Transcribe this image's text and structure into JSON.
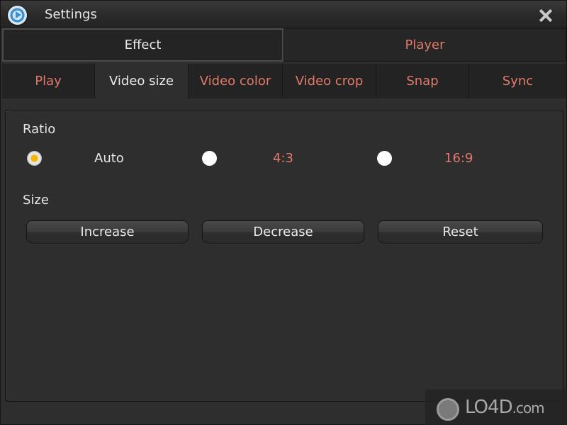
{
  "window": {
    "title": "Settings",
    "close_icon": "close-icon",
    "app_icon": "media-player-icon"
  },
  "top_tabs": [
    {
      "label": "Effect",
      "active": true
    },
    {
      "label": "Player",
      "active": false
    }
  ],
  "sub_tabs": [
    {
      "label": "Play",
      "active": false
    },
    {
      "label": "Video size",
      "active": true
    },
    {
      "label": "Video color",
      "active": false
    },
    {
      "label": "Video crop",
      "active": false
    },
    {
      "label": "Snap",
      "active": false
    },
    {
      "label": "Sync",
      "active": false
    }
  ],
  "ratio": {
    "label": "Ratio",
    "options": [
      {
        "label": "Auto",
        "checked": true
      },
      {
        "label": "4:3",
        "checked": false
      },
      {
        "label": "16:9",
        "checked": false
      }
    ]
  },
  "size": {
    "label": "Size",
    "buttons": [
      "Increase",
      "Decrease",
      "Reset"
    ]
  },
  "watermark": {
    "brand": "LO4D",
    "suffix": ".com"
  },
  "colors": {
    "accent_inactive_text": "#e07a6a",
    "active_text": "#e8e8e8",
    "radio_selected": "#f5b400",
    "background": "#2e2e2e"
  }
}
